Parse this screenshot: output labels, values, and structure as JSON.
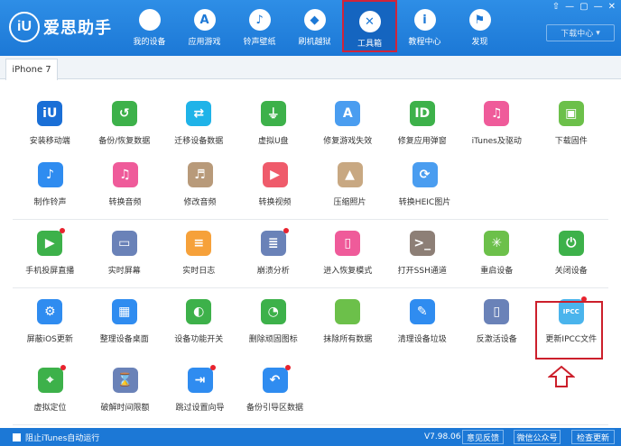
{
  "app": {
    "logo_mark": "iU",
    "logo_text": "爱思助手"
  },
  "nav": [
    {
      "label": "我的设备",
      "icon": "apple-icon",
      "glyph": ""
    },
    {
      "label": "应用游戏",
      "icon": "app-store-icon",
      "glyph": "A"
    },
    {
      "label": "铃声壁纸",
      "icon": "music-wallpaper-icon",
      "glyph": "♪"
    },
    {
      "label": "刷机越狱",
      "icon": "box-icon",
      "glyph": "◆"
    },
    {
      "label": "工具箱",
      "icon": "tools-icon",
      "glyph": "✕",
      "active": true
    },
    {
      "label": "教程中心",
      "icon": "info-icon",
      "glyph": "i"
    },
    {
      "label": "发现",
      "icon": "flag-icon",
      "glyph": "⚑"
    }
  ],
  "window_controls": [
    "⇧",
    "—",
    "▢",
    "—",
    "✕"
  ],
  "download_center": {
    "label": "下载中心",
    "icon": "chevron-down-icon"
  },
  "device_tab": "iPhone 7",
  "tools": [
    [
      {
        "label": "安装移动端",
        "icon": "iu-icon",
        "color": "#1a6fd6",
        "glyph": "iU",
        "dot": false
      },
      {
        "label": "备份/恢复数据",
        "icon": "backup-icon",
        "color": "#3db14a",
        "glyph": "↺",
        "dot": false
      },
      {
        "label": "迁移设备数据",
        "icon": "migrate-icon",
        "color": "#1fb3e8",
        "glyph": "⇄",
        "dot": false
      },
      {
        "label": "虚拟U盘",
        "icon": "usb-icon",
        "color": "#3db14a",
        "glyph": "⏚",
        "dot": false
      },
      {
        "label": "修复游戏失效",
        "icon": "app-store-icon",
        "color": "#4a9df0",
        "glyph": "A",
        "dot": false
      },
      {
        "label": "修复应用弹窗",
        "icon": "apple-id-icon",
        "color": "#3db14a",
        "glyph": "ID",
        "dot": false
      },
      {
        "label": "iTunes及驱动",
        "icon": "itunes-icon",
        "color": "#ef5b9a",
        "glyph": "♫",
        "dot": false
      },
      {
        "label": "下载固件",
        "icon": "cube-icon",
        "color": "#6cc04a",
        "glyph": "▣",
        "dot": false
      }
    ],
    [
      {
        "label": "制作铃声",
        "icon": "bell-icon",
        "color": "#2f8cf0",
        "glyph": "♪",
        "dot": false
      },
      {
        "label": "转换音频",
        "icon": "music-icon",
        "color": "#ef5b9a",
        "glyph": "♫",
        "dot": false
      },
      {
        "label": "修改音频",
        "icon": "audio-edit-icon",
        "color": "#b89a7a",
        "glyph": "♬",
        "dot": false
      },
      {
        "label": "转换视频",
        "icon": "video-icon",
        "color": "#ef5b6b",
        "glyph": "▶",
        "dot": false
      },
      {
        "label": "压缩照片",
        "icon": "photo-icon",
        "color": "#c8a882",
        "glyph": "▲",
        "dot": false
      },
      {
        "label": "转换HEIC图片",
        "icon": "heic-icon",
        "color": "#4a9df0",
        "glyph": "⟳",
        "dot": false
      }
    ],
    [
      {
        "label": "手机投屏直播",
        "icon": "screen-cast-icon",
        "color": "#3db14a",
        "glyph": "▶",
        "dot": true
      },
      {
        "label": "实时屏幕",
        "icon": "monitor-icon",
        "color": "#6a82b8",
        "glyph": "▭",
        "dot": false
      },
      {
        "label": "实时日志",
        "icon": "log-icon",
        "color": "#f6a13a",
        "glyph": "≡",
        "dot": false
      },
      {
        "label": "崩溃分析",
        "icon": "crash-icon",
        "color": "#6a82b8",
        "glyph": "≣",
        "dot": true
      },
      {
        "label": "进入恢复模式",
        "icon": "recovery-icon",
        "color": "#ef5b9a",
        "glyph": "▯",
        "dot": false
      },
      {
        "label": "打开SSH通道",
        "icon": "terminal-icon",
        "color": "#8d7f76",
        "glyph": ">_",
        "dot": false
      },
      {
        "label": "重启设备",
        "icon": "restart-icon",
        "color": "#6cc04a",
        "glyph": "✳",
        "dot": false
      },
      {
        "label": "关闭设备",
        "icon": "power-icon",
        "color": "#3db14a",
        "glyph": "⏻",
        "dot": false
      }
    ],
    [
      {
        "label": "屏蔽iOS更新",
        "icon": "gear-icon",
        "color": "#2f8cf0",
        "glyph": "⚙",
        "dot": false
      },
      {
        "label": "整理设备桌面",
        "icon": "grid-icon",
        "color": "#2f8cf0",
        "glyph": "▦",
        "dot": false
      },
      {
        "label": "设备功能开关",
        "icon": "toggle-icon",
        "color": "#3db14a",
        "glyph": "◐",
        "dot": false
      },
      {
        "label": "删除顽固图标",
        "icon": "pie-icon",
        "color": "#3db14a",
        "glyph": "◔",
        "dot": false
      },
      {
        "label": "抹除所有数据",
        "icon": "apple-erase-icon",
        "color": "#6cc04a",
        "glyph": "",
        "dot": false
      },
      {
        "label": "清理设备垃圾",
        "icon": "broom-icon",
        "color": "#2f8cf0",
        "glyph": "✎",
        "dot": false
      },
      {
        "label": "反激活设备",
        "icon": "deactivate-icon",
        "color": "#6a82b8",
        "glyph": "▯",
        "dot": false
      },
      {
        "label": "更新IPCC文件",
        "icon": "ipcc-icon",
        "color": "#4ab4ec",
        "glyph": "IPCC",
        "dot": true
      }
    ],
    [
      {
        "label": "虚拟定位",
        "icon": "location-icon",
        "color": "#3db14a",
        "glyph": "⌖",
        "dot": true
      },
      {
        "label": "破解时间限额",
        "icon": "hourglass-icon",
        "color": "#6a82b8",
        "glyph": "⌛",
        "dot": false
      },
      {
        "label": "跳过设置向导",
        "icon": "skip-icon",
        "color": "#2f8cf0",
        "glyph": "⇥",
        "dot": true
      },
      {
        "label": "备份引导区数据",
        "icon": "boot-backup-icon",
        "color": "#2f8cf0",
        "glyph": "↶",
        "dot": true
      }
    ]
  ],
  "footer": {
    "itunes_checkbox_label": "阻止iTunes自动运行",
    "version": "V7.98.06",
    "feedback": "意见反馈",
    "wechat": "微信公众号",
    "check_update": "检查更新"
  },
  "colors": {
    "header": "#1c78d6",
    "highlight": "#cc1f2b"
  }
}
